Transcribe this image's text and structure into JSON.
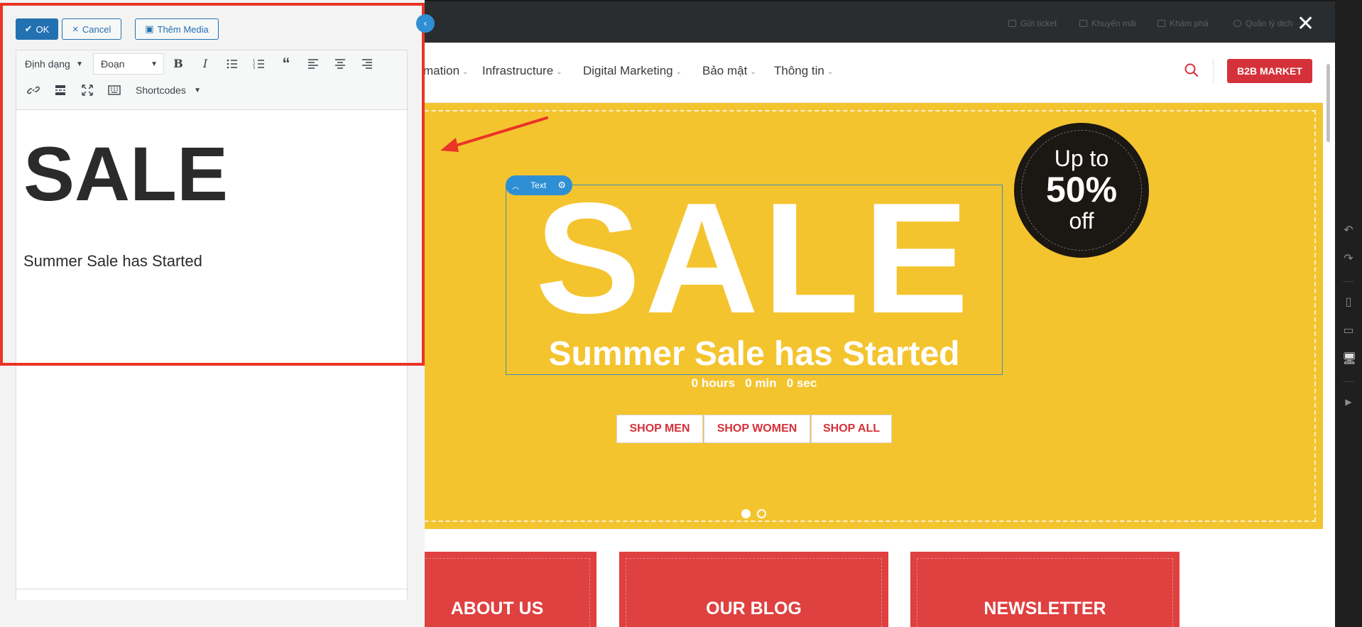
{
  "editor": {
    "ok_label": "OK",
    "cancel_label": "Cancel",
    "media_label": "Thêm Media",
    "format_menu": "Định dạng",
    "block_format": "Đoạn",
    "shortcodes": "Shortcodes",
    "content_heading": "SALE",
    "content_paragraph": "Summer Sale has Started"
  },
  "preview": {
    "topbar": [
      "Gửi ticket",
      "Khuyến mãi",
      "Khám phá",
      "Quản lý dịch"
    ],
    "nav": [
      "mation",
      "Infrastructure",
      "Digital Marketing",
      "Bảo mật",
      "Thông tin"
    ],
    "b2b_label": "B2B MARKET",
    "text_tag": "Text",
    "hero_sale": "SALE",
    "hero_subtitle": "Summer Sale has Started",
    "countdown": "0 hours   0 min   0 sec",
    "badge": {
      "up": "Up to",
      "pct": "50%",
      "off": "off"
    },
    "shop_buttons": [
      "SHOP MEN",
      "SHOP WOMEN",
      "SHOP ALL"
    ],
    "promos": [
      "ABOUT US",
      "OUR BLOG",
      "NEWSLETTER"
    ]
  },
  "colors": {
    "hero_bg": "#f4c42f",
    "accent_red": "#d5313a",
    "promo_red": "#df4040",
    "wp_blue": "#2271b1",
    "annotation_red": "#ea3425"
  },
  "icons": [
    "close-icon",
    "search-icon",
    "undo-icon",
    "redo-icon",
    "mobile-icon",
    "tablet-icon",
    "desktop-icon",
    "play-icon",
    "bold-icon",
    "italic-icon",
    "bullet-list-icon",
    "numbered-list-icon",
    "blockquote-icon",
    "align-left-icon",
    "align-center-icon",
    "align-right-icon",
    "link-icon",
    "read-more-icon",
    "fullscreen-icon",
    "keyboard-icon",
    "media-icon",
    "settings-icon",
    "collapse-icon"
  ]
}
